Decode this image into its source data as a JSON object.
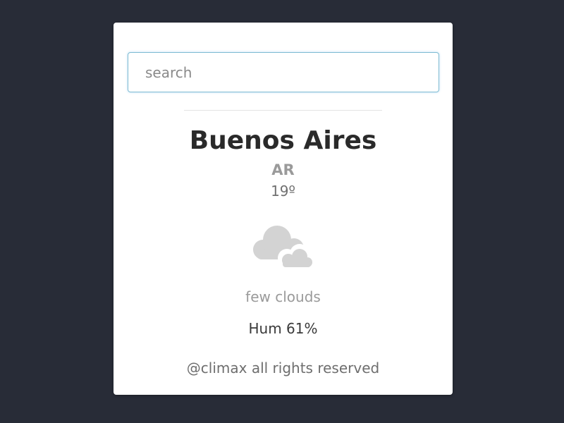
{
  "search": {
    "placeholder": "search",
    "value": ""
  },
  "weather": {
    "city": "Buenos Aires",
    "country": "AR",
    "temperature": "19º",
    "icon": "few-clouds-icon",
    "description": "few clouds",
    "humidity": "Hum 61%"
  },
  "footer": {
    "text": "@climax all rights reserved"
  },
  "colors": {
    "background": "#282c37",
    "card": "#ffffff",
    "input_border": "#7fbcd2",
    "icon": "#d3d3d3"
  }
}
